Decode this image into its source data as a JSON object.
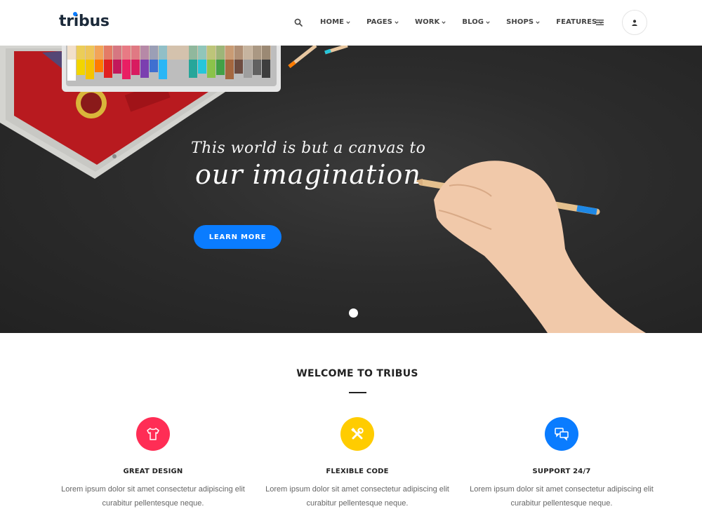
{
  "header": {
    "logo": "tribus",
    "nav": [
      {
        "label": "HOME"
      },
      {
        "label": "PAGES"
      },
      {
        "label": "WORK"
      },
      {
        "label": "BLOG"
      },
      {
        "label": "SHOPS"
      },
      {
        "label": "FEATURES"
      }
    ],
    "icons": {
      "search": "search-icon",
      "menu": "hamburger-menu-icon",
      "user": "user-icon"
    }
  },
  "hero": {
    "headline_line1": "This world is but a canvas to",
    "headline_line2": "our imagination",
    "cta_label": "LEARN MORE",
    "slides_count": 1,
    "active_slide": 1
  },
  "welcome": {
    "title": "WELCOME TO TRIBUS",
    "features": [
      {
        "title": "GREAT DESIGN",
        "text": "Lorem ipsum dolor sit amet consectetur adipiscing elit curabitur pellentesque neque.",
        "icon": "tshirt-icon",
        "color": "#ff2d55"
      },
      {
        "title": "FLEXIBLE CODE",
        "text": "Lorem ipsum dolor sit amet consectetur adipiscing elit curabitur pellentesque neque.",
        "icon": "tools-icon",
        "color": "#ffcc00"
      },
      {
        "title": "SUPPORT 24/7",
        "text": "Lorem ipsum dolor sit amet consectetur adipiscing elit curabitur pellentesque neque.",
        "icon": "chat-bubbles-icon",
        "color": "#0a7cff"
      }
    ]
  },
  "colors": {
    "accent": "#0a7cff",
    "dark_text": "#222222",
    "hero_bg": "#2c2c2c"
  }
}
